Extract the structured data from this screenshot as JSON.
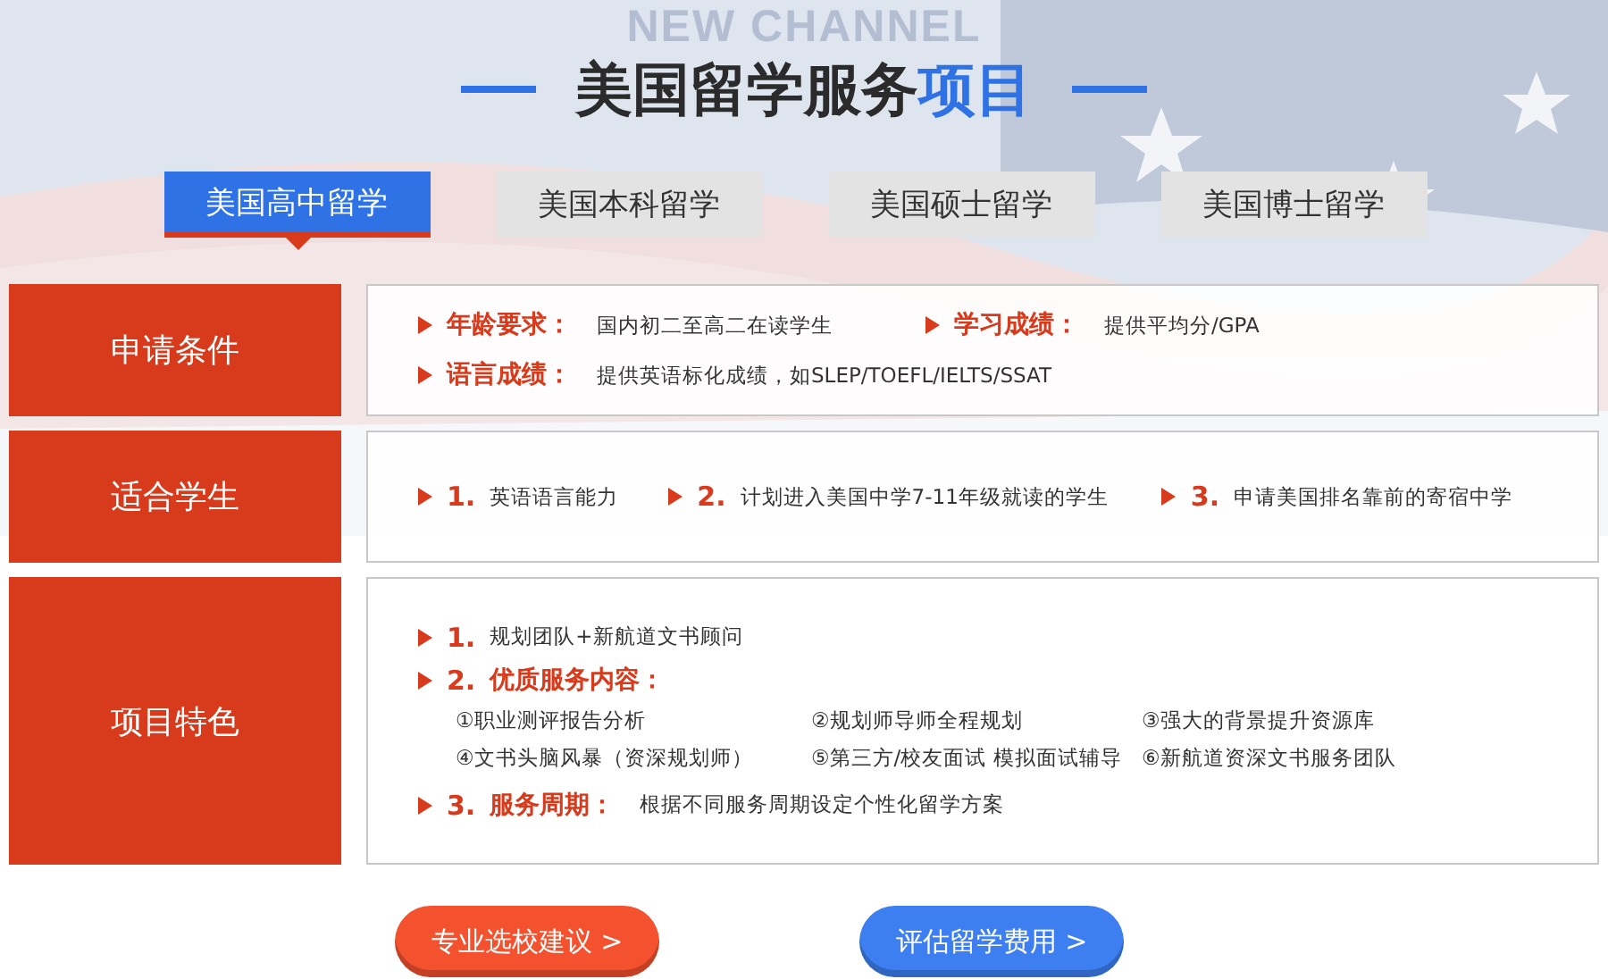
{
  "background_text": "NEW CHANNEL",
  "title": {
    "main": "美国留学服务",
    "accent": "项目"
  },
  "tabs": [
    {
      "label": "美国高中留学",
      "selected": true
    },
    {
      "label": "美国本科留学",
      "selected": false
    },
    {
      "label": "美国硕士留学",
      "selected": false
    },
    {
      "label": "美国博士留学",
      "selected": false
    }
  ],
  "sections": [
    {
      "label": "申请条件",
      "kind": "fields",
      "lines": [
        [
          {
            "key": "年龄要求：",
            "value": "国内初二至高二在读学生"
          },
          {
            "key": "学习成绩：",
            "value": "提供平均分/GPA"
          }
        ],
        [
          {
            "key": "语言成绩：",
            "value": "提供英语标化成绩，如SLEP/TOEFL/IELTS/SSAT"
          }
        ]
      ]
    },
    {
      "label": "适合学生",
      "kind": "numbered_row",
      "items": [
        {
          "number": "1.",
          "text": "英语语言能力"
        },
        {
          "number": "2.",
          "text": "计划进入美国中学7-11年级就读的学生"
        },
        {
          "number": "3.",
          "text": "申请美国排名靠前的寄宿中学"
        }
      ]
    },
    {
      "label": "项目特色",
      "kind": "features",
      "items": [
        {
          "number": "1.",
          "text": "规划团队+新航道文书顾问"
        },
        {
          "number": "2.",
          "heading": "优质服务内容：",
          "services": [
            "①职业测评报告分析",
            "②规划师导师全程规划",
            "③强大的背景提升资源库",
            "④文书头脑风暴（资深规划师）",
            "⑤第三方/校友面试 模拟面试辅导",
            "⑥新航道资深文书服务团队"
          ]
        },
        {
          "number": "3.",
          "heading": "服务周期：",
          "text": "根据不同服务周期设定个性化留学方案"
        }
      ]
    }
  ],
  "buttons": [
    {
      "label": "专业选校建议 >",
      "color": "#f4512f"
    },
    {
      "label": "评估留学费用 >",
      "color": "#3d7ff0"
    }
  ]
}
